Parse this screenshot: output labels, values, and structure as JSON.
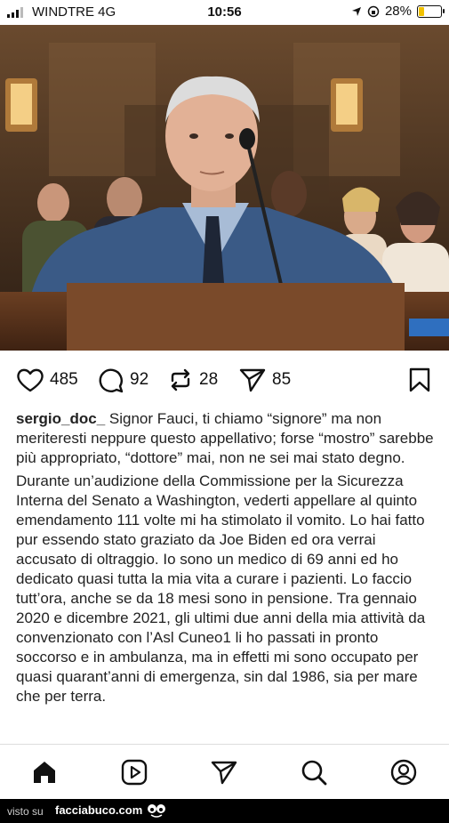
{
  "status": {
    "carrier": "WINDTRE  4G",
    "time": "10:56",
    "battery": "28%",
    "battery_level": 0.28
  },
  "actions": {
    "likes": "485",
    "comments": "92",
    "reposts": "28",
    "shares": "85"
  },
  "caption": {
    "username": "sergio_doc_",
    "intro": "Signor Fauci, ti chiamo “signore” ma non meriteresti neppure questo appellativo; forse “mostro” sarebbe più appropriato, “dottore” mai, non ne sei mai stato degno.",
    "body": "Durante un’audizione della Commissione per la Sicurezza Interna del Senato a Washington, vederti appellare al quinto emendamento 111 volte mi ha stimolato il vomito. Lo hai fatto pur essendo stato graziato da Joe Biden ed ora verrai accusato di oltraggio. Io sono un medico di 69 anni ed ho dedicato quasi tutta la mia vita a curare i pazienti. Lo faccio tutt’ora, anche se da 18 mesi sono in pensione. Tra gennaio 2020 e dicembre 2021, gli ultimi due anni della mia attività da convenzionato con l’Asl Cuneo1 li ho passati in pronto soccorso e in ambulanza, ma in effetti mi sono occupato per quasi quarant’anni di emergenza, sin dal 1986, sia per mare che per terra."
  },
  "nav": [
    "home-icon",
    "reels-icon",
    "send-icon",
    "search-icon",
    "profile-icon"
  ],
  "footer": {
    "prefix": "visto su",
    "site": "facciabuco.com"
  }
}
